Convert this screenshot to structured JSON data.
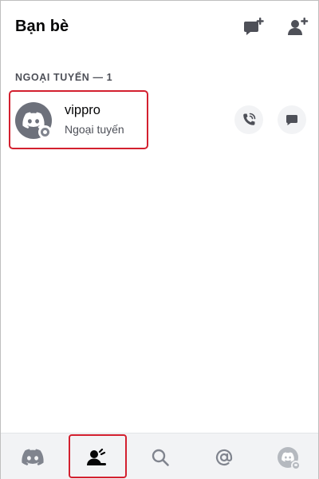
{
  "header": {
    "title": "Bạn bè",
    "new_dm_icon": "chat-bubble-plus-icon",
    "add_friend_icon": "person-plus-icon"
  },
  "section": {
    "heading": "NGOẠI TUYẾN — 1"
  },
  "friends": [
    {
      "name": "vippro",
      "status": "Ngoại tuyến",
      "avatar_icon": "discord-logo-icon",
      "status_indicator": "offline"
    }
  ],
  "friend_actions": {
    "call_icon": "phone-call-icon",
    "message_icon": "chat-bubble-icon"
  },
  "bottom_nav": {
    "items": [
      {
        "key": "home",
        "icon": "discord-logo-icon"
      },
      {
        "key": "friends",
        "icon": "friends-wave-icon",
        "active": true
      },
      {
        "key": "search",
        "icon": "search-icon"
      },
      {
        "key": "mentions",
        "icon": "at-sign-icon"
      },
      {
        "key": "profile",
        "icon": "avatar-icon"
      }
    ]
  },
  "colors": {
    "highlight_red": "#d3202f",
    "avatar_gray": "#6d717b",
    "offline_gray": "#80848e",
    "nav_bg": "#f2f3f5",
    "icon_dark": "#4e5058"
  }
}
